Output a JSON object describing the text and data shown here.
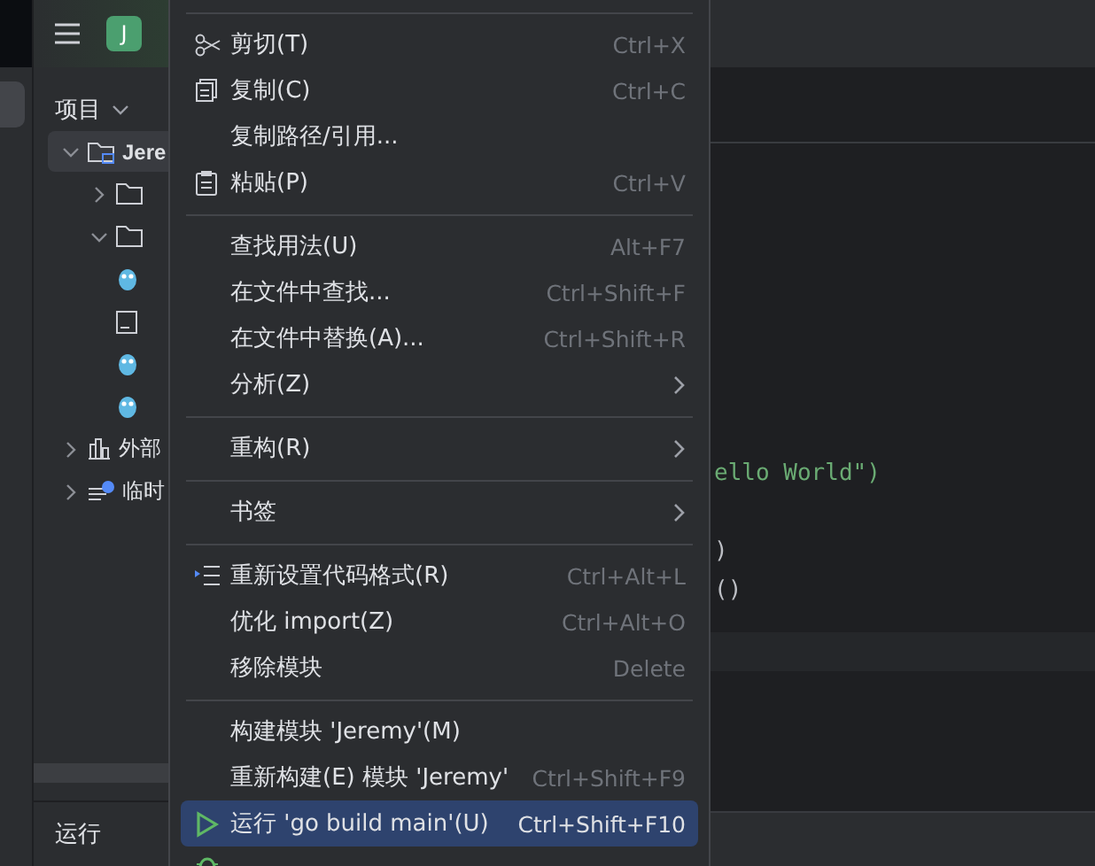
{
  "header": {
    "project_badge": "J"
  },
  "project_panel": {
    "title": "项目",
    "tree": [
      {
        "kind": "module",
        "label": "Jere",
        "expanded": true,
        "selected": true,
        "children": [
          {
            "kind": "folder",
            "expanded": false,
            "selected": false
          },
          {
            "kind": "folder",
            "expanded": true,
            "selected": false
          },
          {
            "kind": "gofile",
            "selected": false
          },
          {
            "kind": "textfile",
            "selected": false
          },
          {
            "kind": "gofile",
            "selected": false
          },
          {
            "kind": "gofile",
            "selected": false
          }
        ]
      },
      {
        "kind": "library",
        "label": "外部",
        "expanded": false,
        "selected": false
      },
      {
        "kind": "scratch",
        "label": "临时",
        "expanded": false,
        "selected": false
      }
    ]
  },
  "bottom_panel": {
    "title": "运行"
  },
  "editor": {
    "lines": [
      {
        "text": "ello World\")",
        "kind": "string"
      },
      {
        "kind": "blank"
      },
      {
        "text": ")",
        "kind": "call"
      },
      {
        "text": "()",
        "kind": "call"
      }
    ]
  },
  "context_menu": {
    "items": [
      {
        "kind": "separator"
      },
      {
        "kind": "cut",
        "label": "剪切(T)",
        "shortcut": "Ctrl+X",
        "selected": false
      },
      {
        "kind": "copy",
        "label": "复制(C)",
        "shortcut": "Ctrl+C",
        "selected": false
      },
      {
        "kind": "item",
        "label": "复制路径/引用...",
        "selected": false
      },
      {
        "kind": "paste",
        "label": "粘贴(P)",
        "shortcut": "Ctrl+V",
        "selected": false
      },
      {
        "kind": "separator"
      },
      {
        "kind": "item",
        "label": "查找用法(U)",
        "shortcut": "Alt+F7",
        "selected": false
      },
      {
        "kind": "item",
        "label": "在文件中查找...",
        "shortcut": "Ctrl+Shift+F",
        "selected": false
      },
      {
        "kind": "item",
        "label": "在文件中替换(A)...",
        "shortcut": "Ctrl+Shift+R",
        "selected": false
      },
      {
        "kind": "item",
        "label": "分析(Z)",
        "submenu": true,
        "selected": false
      },
      {
        "kind": "separator"
      },
      {
        "kind": "item",
        "label": "重构(R)",
        "submenu": true,
        "selected": false
      },
      {
        "kind": "separator"
      },
      {
        "kind": "item",
        "label": "书签",
        "submenu": true,
        "selected": false
      },
      {
        "kind": "separator"
      },
      {
        "kind": "format",
        "label": "重新设置代码格式(R)",
        "shortcut": "Ctrl+Alt+L",
        "selected": false
      },
      {
        "kind": "item",
        "label": "优化 import(Z)",
        "shortcut": "Ctrl+Alt+O",
        "selected": false
      },
      {
        "kind": "item",
        "label": "移除模块",
        "shortcut": "Delete",
        "selected": false
      },
      {
        "kind": "separator"
      },
      {
        "kind": "item",
        "label": "构建模块 'Jeremy'(M)",
        "selected": false
      },
      {
        "kind": "item",
        "label": "重新构建(E) 模块 'Jeremy'",
        "shortcut": "Ctrl+Shift+F9",
        "selected": false
      },
      {
        "kind": "run",
        "label": "运行 'go build main'(U)",
        "shortcut": "Ctrl+Shift+F10",
        "selected": true
      },
      {
        "kind": "debug",
        "selected": false
      }
    ]
  }
}
